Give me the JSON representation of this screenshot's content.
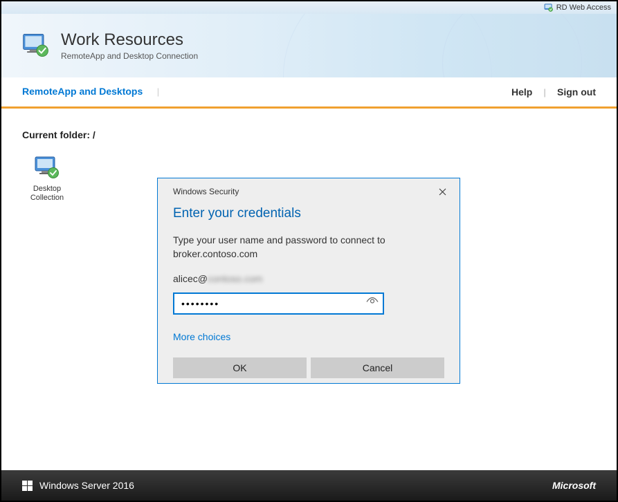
{
  "top_bar": {
    "label": "RD Web Access"
  },
  "header": {
    "title": "Work Resources",
    "subtitle": "RemoteApp and Desktop Connection"
  },
  "nav": {
    "tab_label": "RemoteApp and Desktops",
    "help_label": "Help",
    "signout_label": "Sign out"
  },
  "content": {
    "folder_label": "Current folder: /",
    "apps": [
      {
        "label": "Desktop Collection"
      }
    ]
  },
  "dialog": {
    "window_title": "Windows Security",
    "heading": "Enter your credentials",
    "message": "Type your user name and password to connect to broker.contoso.com",
    "username_visible": "alicec@",
    "username_blurred": "contoso.com",
    "password_dots": "••••••••",
    "more_choices": "More choices",
    "ok_label": "OK",
    "cancel_label": "Cancel"
  },
  "footer": {
    "os_label": "Windows Server 2016",
    "brand": "Microsoft"
  }
}
